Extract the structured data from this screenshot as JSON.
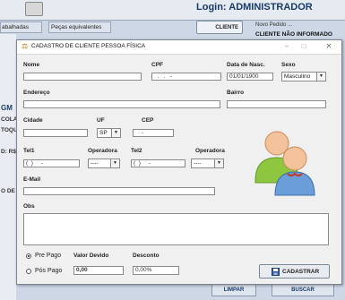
{
  "background": {
    "tabs": [
      "abalhadas",
      "Peças equivalentes"
    ],
    "login_label": "Login: ADMINISTRADOR",
    "novo_pedido": "Novo Pedido ...",
    "cliente_button": "CLIENTE",
    "cliente_status": "CLIENTE NÃO INFORMADO",
    "left_fragments": [
      "GM",
      "COLA",
      "TOQU",
      "D: R$",
      "O DE"
    ],
    "bottom_buttons": [
      "LIMPAR",
      "BUSCAR"
    ]
  },
  "window": {
    "title": "CADASTRO DE CLIENTE PESSOA FÍSICA",
    "controls": [
      "minimize",
      "maximize",
      "close"
    ]
  },
  "form": {
    "nome_label": "Nome",
    "nome_value": "",
    "cpf_label": "CPF",
    "cpf_mask": "  .   .   -",
    "nasc_label": "Data de Nasc.",
    "nasc_value": "01/01/1900",
    "sexo_label": "Sexo",
    "sexo_value": "Masculino",
    "endereco_label": "Endereço",
    "bairro_label": "Bairro",
    "cidade_label": "Cidade",
    "uf_label": "UF",
    "uf_value": "SP",
    "cep_label": "CEP",
    "cep_mask": "    -",
    "tel1_label": "Tel1",
    "tel1_mask": "(  )     -",
    "operadora1_label": "Operadora",
    "operadora1_value": "----",
    "tel2_label": "Tel2",
    "tel2_mask": "(  )     -",
    "operadora2_label": "Operadora",
    "operadora2_value": "----",
    "email_label": "E-Mail",
    "obs_label": "Obs",
    "pre_pago_label": "Pre Pago",
    "pos_pago_label": "Pós Pago",
    "payment_selected": "Pre Pago",
    "valor_label": "Valor Devido",
    "valor_value": "0,00",
    "desconto_label": "Desconto",
    "desconto_value": "0,00%",
    "cadastrar_label": "CADASTRAR"
  },
  "icons": [
    "users-icon",
    "save-icon",
    "window-icon"
  ]
}
